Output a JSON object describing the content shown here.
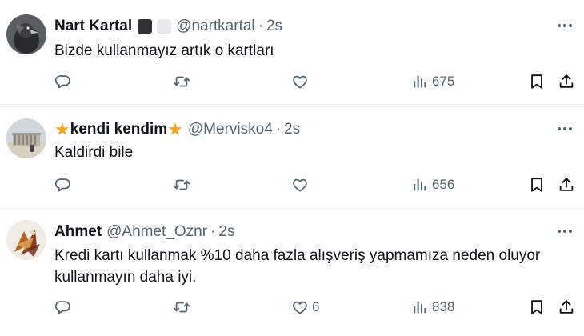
{
  "tweets": [
    {
      "name": "Nart Kartal",
      "handle": "@nartkartal",
      "sep": "·",
      "time": "2s",
      "text": "Bizde kullanmayız artık o kartları",
      "likes": "",
      "views": "675"
    },
    {
      "name": "kendi kendim",
      "name_prefix": "★",
      "name_suffix": "★",
      "handle": "@Mervisko4",
      "sep": "·",
      "time": "2s",
      "text": "Kaldirdi bile",
      "likes": "",
      "views": "656"
    },
    {
      "name": "Ahmet",
      "handle": "@Ahmet_Oznr",
      "sep": "·",
      "time": "2s",
      "text": "Kredi kartı kullanmak %10 daha fazla alışveriş yapmamıza neden oluyor kullanmayın daha iyi.",
      "likes": "6",
      "views": "838"
    }
  ],
  "colors": {
    "text": "#0f1419",
    "muted": "#536471",
    "divider": "#eff3f4",
    "star": "#f5a623",
    "badge_dark": "#2f3336",
    "badge_light": "#e7e9ea"
  },
  "icons": [
    "avatar",
    "more-icon",
    "reply-icon",
    "retweet-icon",
    "like-icon",
    "views-icon",
    "bookmark-icon",
    "share-icon"
  ]
}
